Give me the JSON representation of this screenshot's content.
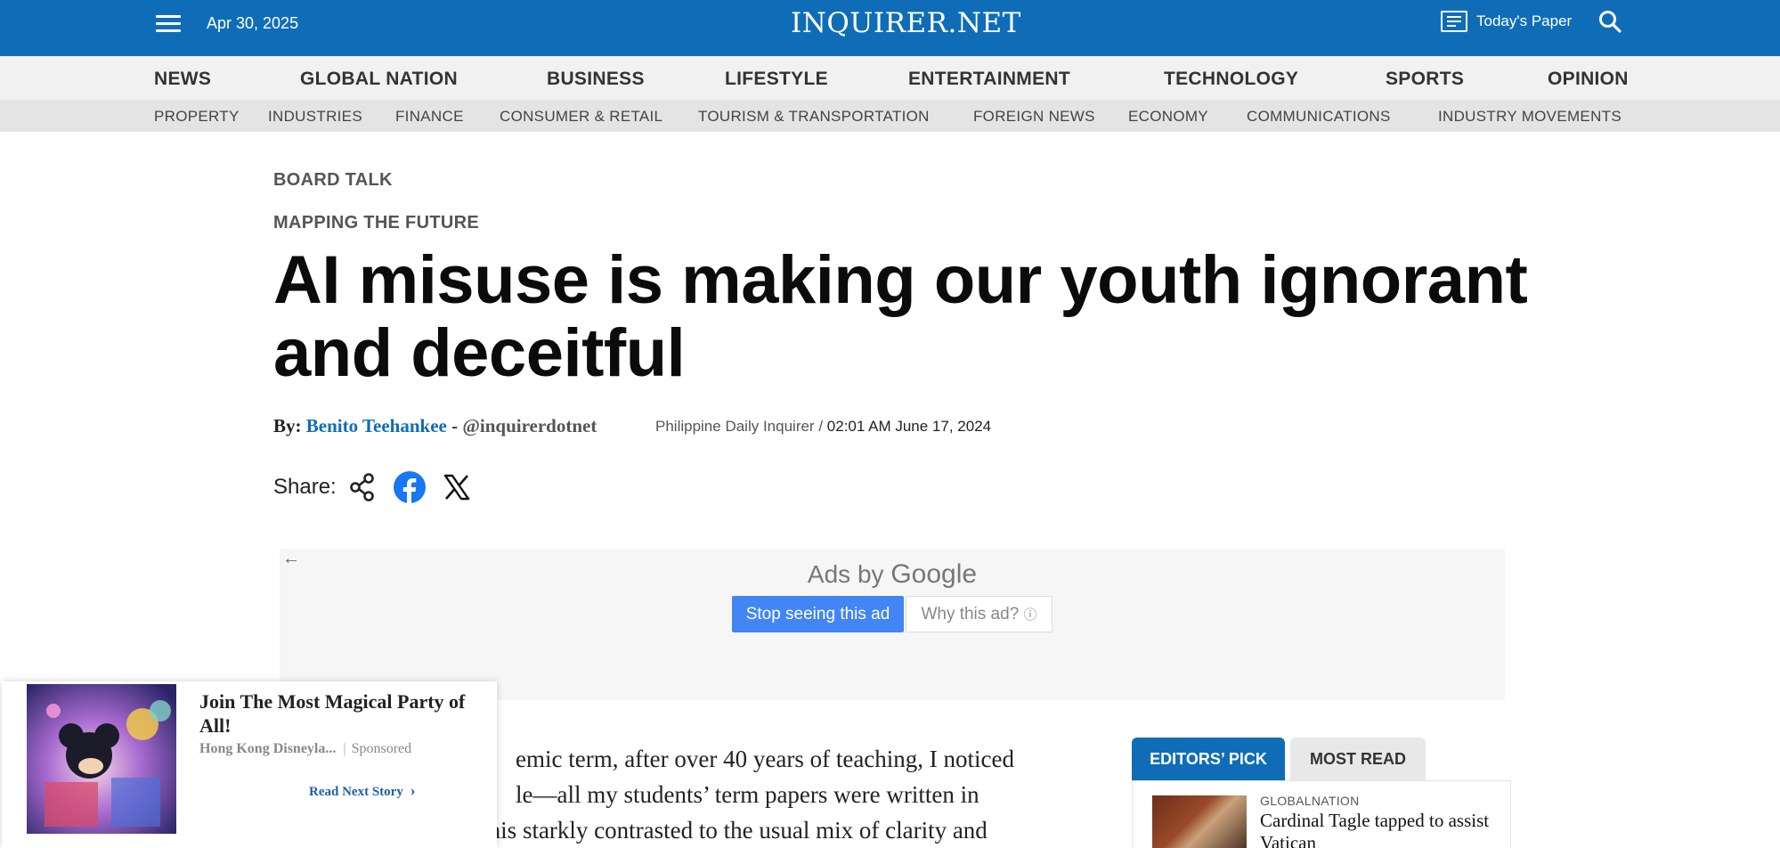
{
  "header": {
    "date": "Apr 30, 2025",
    "logo": "INQUIRER.NET",
    "todays_paper": "Today's Paper"
  },
  "main_nav": [
    "NEWS",
    "GLOBAL NATION",
    "BUSINESS",
    "LIFESTYLE",
    "ENTERTAINMENT",
    "TECHNOLOGY",
    "SPORTS",
    "OPINION"
  ],
  "sub_nav": [
    "PROPERTY",
    "INDUSTRIES",
    "FINANCE",
    "CONSUMER & RETAIL",
    "TOURISM & TRANSPORTATION",
    "FOREIGN NEWS",
    "ECONOMY",
    "COMMUNICATIONS",
    "INDUSTRY MOVEMENTS"
  ],
  "article": {
    "section": "BOARD TALK",
    "column": "MAPPING THE FUTURE",
    "headline": "AI misuse is making our youth ignorant and deceitful",
    "by_label": "By:",
    "author": "Benito Teehankee",
    "dash": "-",
    "handle": "@inquirerdotnet",
    "publication": "Philippine Daily Inquirer",
    "separator": "/",
    "timestamp": "02:01 AM June 17, 2024",
    "share_label": "Share:",
    "body_lines": [
      "emic term, after over 40 years of teaching, I noticed",
      "le—all my students’ term papers were written in",
      "impeccable English. This starkly contrasted to the usual mix of clarity and"
    ]
  },
  "ad": {
    "ads_by": "Ads by",
    "google": "Google",
    "stop_button": "Stop seeing this ad",
    "why_button": "Why this ad?",
    "info_glyph": "ⓘ"
  },
  "sidebar": {
    "tabs": [
      "EDITORS’ PICK",
      "MOST READ"
    ],
    "story": {
      "category": "GLOBALNATION",
      "title": "Cardinal Tagle tapped to assist Vatican"
    }
  },
  "promo": {
    "title": "Join The Most Magical Party of All!",
    "source": "Hong Kong Disneyla...",
    "separator": "|",
    "sponsored": "Sponsored",
    "link": "Read Next Story",
    "link_chevron": "›"
  },
  "colors": {
    "brand_blue": "#0f6db8",
    "google_blue": "#4285f4",
    "nav_bg": "#f1f1f1",
    "subnav_bg": "#e4e4e4"
  },
  "icons": [
    "menu-icon",
    "newspaper-icon",
    "search-icon",
    "share-icon",
    "facebook-icon",
    "x-icon",
    "back-arrow-icon",
    "info-icon",
    "chevron-right-icon"
  ]
}
